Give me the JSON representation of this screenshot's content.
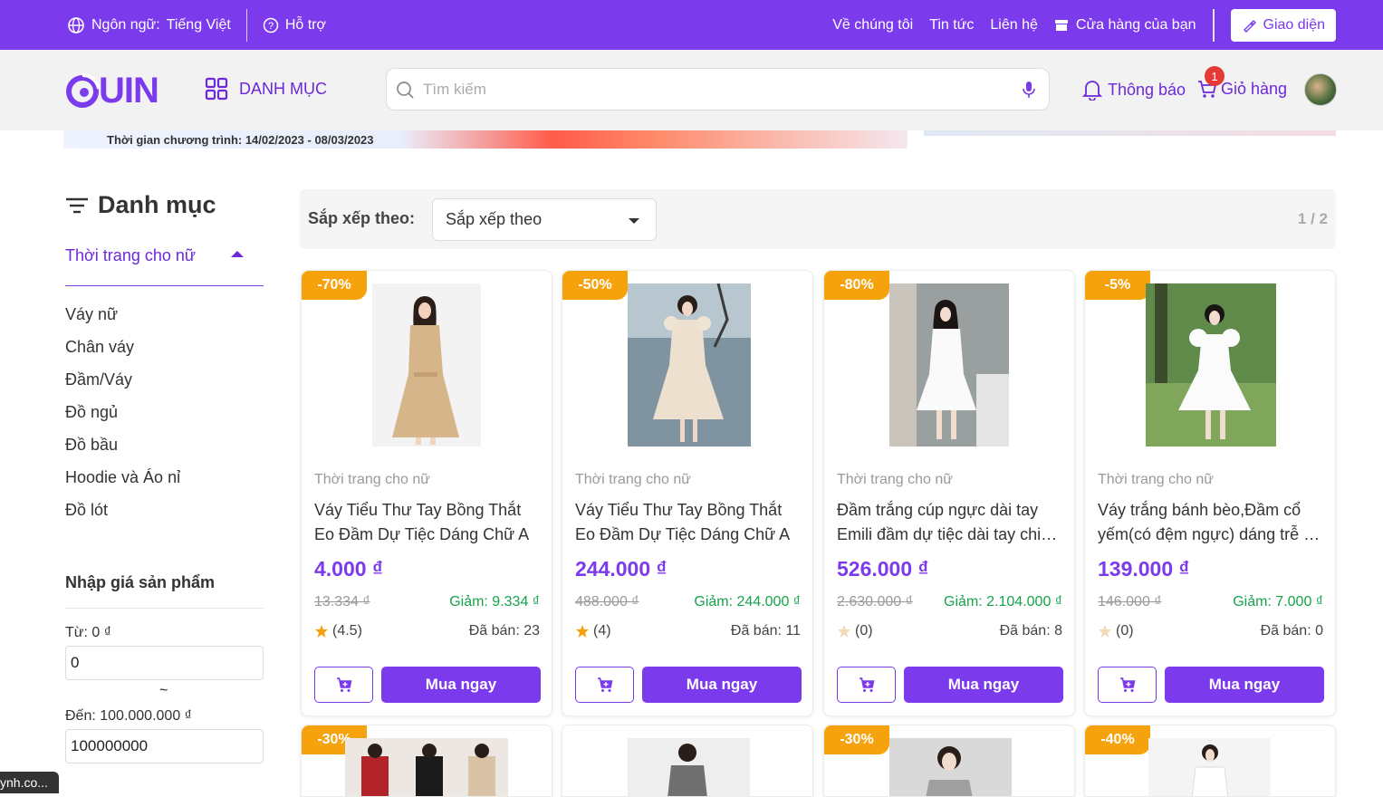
{
  "topbar": {
    "language_label": "Ngôn ngữ:",
    "language_value": "Tiếng Việt",
    "support": "Hỗ trợ",
    "about": "Về chúng tôi",
    "news": "Tin tức",
    "contact": "Liên hệ",
    "your_store": "Cửa hàng của bạn",
    "theme": "Giao diện"
  },
  "header": {
    "logo_text": "UIN",
    "category_button": "DANH MỤC",
    "search_placeholder": "Tìm kiếm",
    "notifications": "Thông báo",
    "cart": "Giỏ hàng",
    "cart_count": "1"
  },
  "banner": {
    "text": "Thời gian chương trình: 14/02/2023 - 08/03/2023"
  },
  "sidebar": {
    "title": "Danh mục",
    "current_category": "Thời trang cho nữ",
    "items": [
      "Váy nữ",
      "Chân váy",
      "Đầm/Váy",
      "Đồ ngủ",
      "Đồ bầu",
      "Hoodie và Áo nỉ",
      "Đồ lót"
    ],
    "price_title": "Nhập giá sản phẩm",
    "from_label": "Từ: 0 ₫",
    "from_value": "0",
    "tilde": "~",
    "to_label": "Đến: 100.000.000 ₫",
    "to_value": "100000000"
  },
  "status_url": "ynh.co...",
  "sort": {
    "label": "Sắp xếp theo:",
    "selected": "Sắp xếp theo",
    "page": "1 / 2"
  },
  "buy_label": "Mua ngay",
  "colors": {
    "accent": "#7c3aed",
    "discount_badge": "#f5a20c",
    "discount_text": "#16a34a"
  },
  "products": [
    {
      "discount": "-70%",
      "category": "Thời trang cho nữ",
      "name_l1": "Váy Tiểu Thư Tay Bồng Thắt",
      "name_l2": "Eo Đầm Dự Tiệc Dáng Chữ A",
      "price": "4.000 ₫",
      "old_price": "13.334 ₫",
      "saving": "Giảm: 9.334 ₫",
      "rating": "(4.5)",
      "sold": "Đã bán: 23"
    },
    {
      "discount": "-50%",
      "category": "Thời trang cho nữ",
      "name_l1": "Váy Tiểu Thư Tay Bồng Thắt",
      "name_l2": "Eo Đầm Dự Tiệc Dáng Chữ A",
      "price": "244.000 ₫",
      "old_price": "488.000 ₫",
      "saving": "Giảm: 244.000 ₫",
      "rating": "(4)",
      "sold": "Đã bán: 11"
    },
    {
      "discount": "-80%",
      "category": "Thời trang cho nữ",
      "name_l1": "Đầm trắng cúp ngực dài tay",
      "name_l2": "Emili đầm dự tiệc dài tay chiết eo",
      "price": "526.000 ₫",
      "old_price": "2.630.000 ₫",
      "saving": "Giảm: 2.104.000 ₫",
      "rating": "(0)",
      "sold": "Đã bán: 8"
    },
    {
      "discount": "-5%",
      "category": "Thời trang cho nữ",
      "name_l1": "Váy trắng bánh bèo,Đầm cổ",
      "name_l2": "yếm(có đệm ngực) dáng trễ vai",
      "price": "139.000 ₫",
      "old_price": "146.000 ₫",
      "saving": "Giảm: 7.000 ₫",
      "rating": "(0)",
      "sold": "Đã bán: 0"
    }
  ],
  "products_row2": [
    {
      "discount": "-30%"
    },
    {
      "discount": ""
    },
    {
      "discount": "-30%"
    },
    {
      "discount": "-40%"
    }
  ]
}
